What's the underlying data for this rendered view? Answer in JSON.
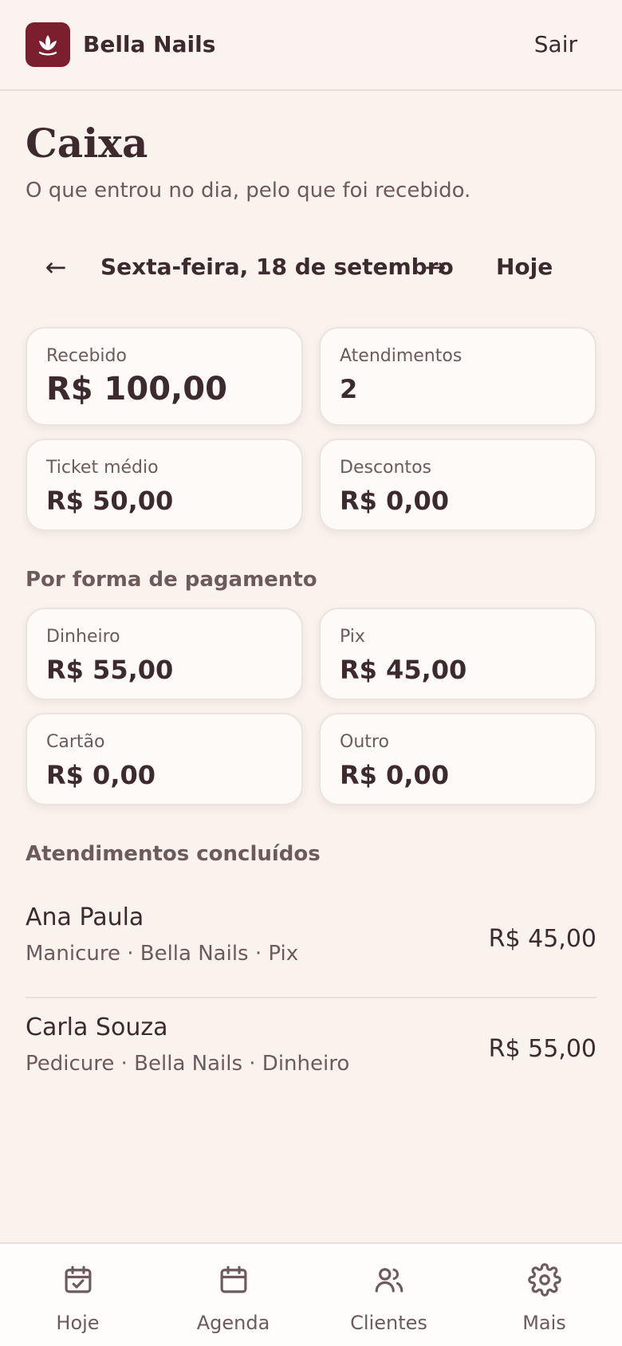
{
  "colors": {
    "brand": "#7b1f2e",
    "background": "#faf2ed",
    "text_primary": "#3d2a2e",
    "text_secondary": "#6e5a5d"
  },
  "header": {
    "brand_name": "Bella Nails",
    "logo_icon": "lotus-icon",
    "logout_label": "Sair"
  },
  "page": {
    "title": "Caixa",
    "subtitle": "O que entrou no dia, pelo que foi recebido."
  },
  "date_nav": {
    "prev_icon": "arrow-left-icon",
    "prev_label": "←",
    "date_label": "Sexta-feira, 18 de setembro",
    "next_icon": "arrow-right-icon",
    "next_label": "→",
    "today_label": "Hoje"
  },
  "summary": [
    {
      "label": "Recebido",
      "value": "R$ 100,00"
    },
    {
      "label": "Atendimentos",
      "value": "2"
    },
    {
      "label": "Ticket médio",
      "value": "R$ 50,00"
    },
    {
      "label": "Descontos",
      "value": "R$ 0,00"
    }
  ],
  "payment_methods": {
    "heading": "Por forma de pagamento",
    "items": [
      {
        "label": "Dinheiro",
        "value": "R$ 55,00"
      },
      {
        "label": "Pix",
        "value": "R$ 45,00"
      },
      {
        "label": "Cartão",
        "value": "R$ 0,00"
      },
      {
        "label": "Outro",
        "value": "R$ 0,00"
      }
    ]
  },
  "completed": {
    "heading": "Atendimentos concluídos",
    "items": [
      {
        "name": "Ana Paula",
        "details": "Manicure · Bella Nails · Pix",
        "amount": "R$ 45,00"
      },
      {
        "name": "Carla Souza",
        "details": "Pedicure · Bella Nails · Dinheiro",
        "amount": "R$ 55,00"
      }
    ]
  },
  "bottom_nav": [
    {
      "label": "Hoje",
      "icon": "calendar-check-icon"
    },
    {
      "label": "Agenda",
      "icon": "calendar-icon"
    },
    {
      "label": "Clientes",
      "icon": "users-icon"
    },
    {
      "label": "Mais",
      "icon": "gear-icon"
    }
  ]
}
